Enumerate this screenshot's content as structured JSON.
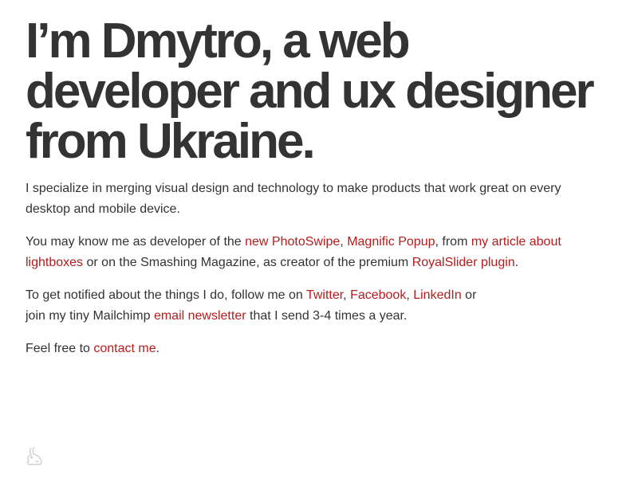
{
  "headline": {
    "line1": "I’m Dmytro, a web",
    "line2": "developer and ux designer",
    "line3": "from Ukraine."
  },
  "intro": {
    "p1": "I specialize in merging visual design and technology to make products that work great on every desktop and mobile device.",
    "p2": {
      "t1": "You may know me as developer of the ",
      "link_photoswipe": "new PhotoSwipe",
      "t2": ", ",
      "link_magnific": "Magnific Popup",
      "t3": ", from ",
      "link_article": "my article about lightboxes",
      "t4": " or on the Smashing Magazine, as creator of the premium ",
      "link_royalslider": "RoyalSlider plugin",
      "t5": "."
    },
    "p3": {
      "t1": "To get notified about the things I do, follow me on ",
      "link_twitter": "Twitter",
      "t2": ", ",
      "link_facebook": "Facebook",
      "t3": ", ",
      "link_linkedin": "LinkedIn",
      "t4": " or",
      "t5": "join my tiny Mailchimp ",
      "link_newsletter": "email newsletter",
      "t6": " that I send 3-4 times a year."
    },
    "p4": {
      "t1": "Feel free to ",
      "link_contact": "contact me",
      "t2": "."
    }
  },
  "colors": {
    "text": "#333333",
    "link": "#b51c1c",
    "background": "#ffffff"
  },
  "icons": {
    "footer": "rabbit-icon"
  }
}
